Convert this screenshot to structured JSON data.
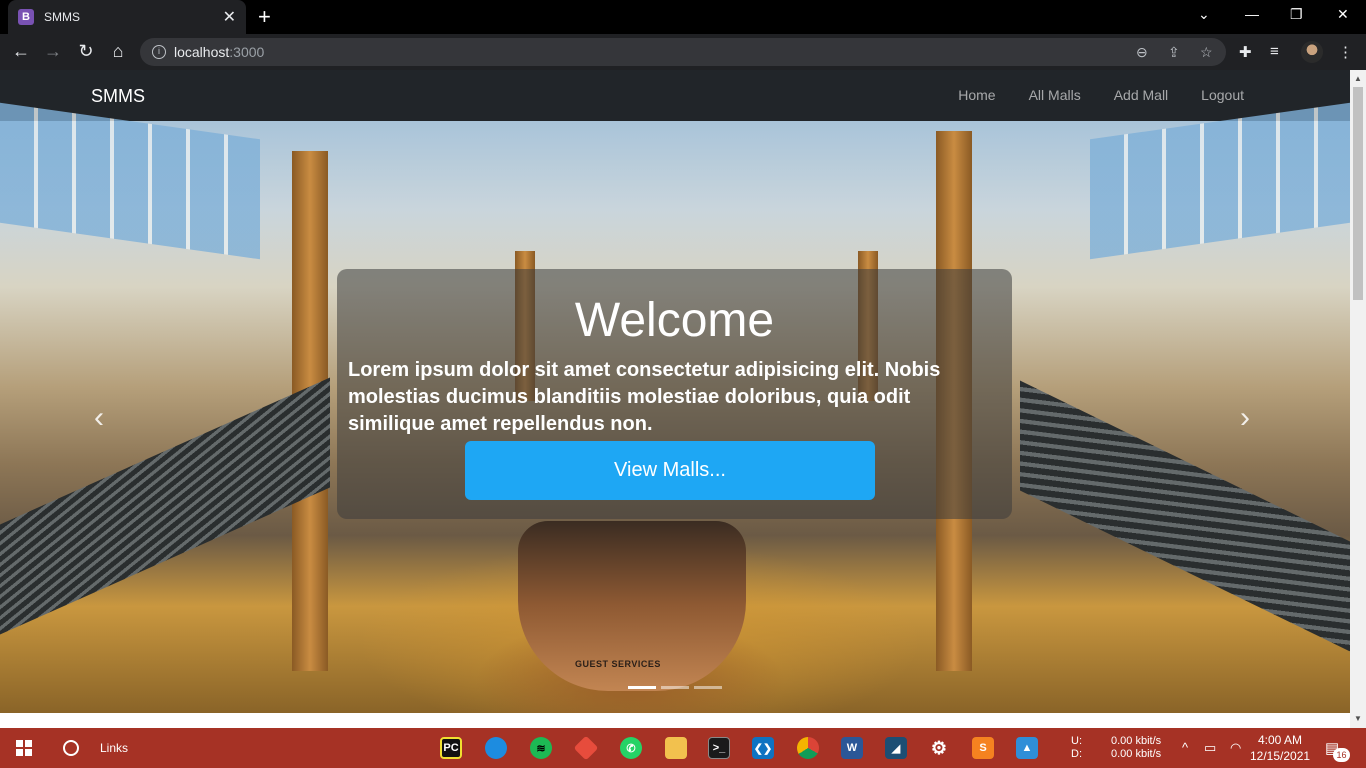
{
  "browser": {
    "tab_title": "SMMS",
    "favicon_letter": "B",
    "url_host": "localhost",
    "url_port": ":3000"
  },
  "navbar": {
    "brand": "SMMS",
    "links": [
      "Home",
      "All Malls",
      "Add Mall",
      "Logout"
    ]
  },
  "hero": {
    "title": "Welcome",
    "text": "Lorem ipsum dolor sit amet consectetur adipisicing elit. Nobis molestias ducimus blanditiis molestiae doloribus, quia odit similique amet repellendus non.",
    "button_label": "View Malls...",
    "kiosk_sign": "GUEST SERVICES",
    "slide_count": 3,
    "active_slide": 1
  },
  "taskbar": {
    "search_label": "Links",
    "apps": [
      "PyCharm",
      "Edge",
      "Spotify",
      "Git",
      "WhatsApp",
      "File Explorer",
      "Terminal",
      "VS Code",
      "Chrome",
      "Word",
      "MySQL Workbench",
      "Settings",
      "Sublime Text",
      "Photos"
    ],
    "net_upload_label": "U:",
    "net_download_label": "D:",
    "net_upload": "0.00 kbit/s",
    "net_download": "0.00 kbit/s",
    "time": "4:00 AM",
    "date": "12/15/2021",
    "notification_count": "16"
  },
  "colors": {
    "navbar_bg": "#212529",
    "button_bg": "#1ea7f4",
    "taskbar_bg": "#a63225"
  }
}
